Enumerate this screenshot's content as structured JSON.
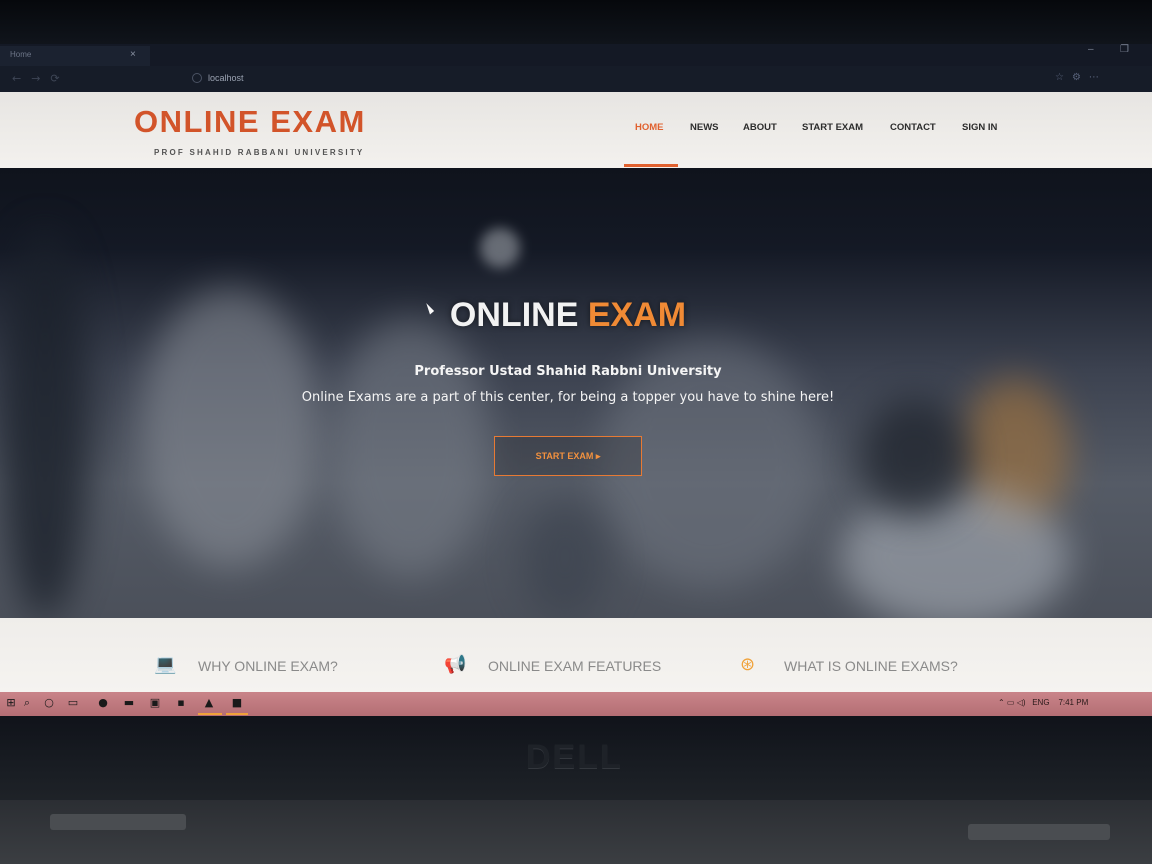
{
  "browser": {
    "tab_title": "Home",
    "tab_close": "×",
    "address": "localhost",
    "window_min": "–",
    "window_max": "❐"
  },
  "site": {
    "logo_title": "ONLINE EXAM",
    "logo_subtitle": "PROF SHAHID RABBANI UNIVERSITY",
    "nav": {
      "home": "HOME",
      "news": "NEWS",
      "about": "ABOUT",
      "start_exam": "START EXAM",
      "contact": "CONTACT",
      "sign_in": "SIGN IN"
    },
    "hero": {
      "title_part1": "ONLINE",
      "title_part2": "EXAM",
      "line1": "Professor Ustad Shahid Rabbni University",
      "line2": "Online Exams are a part of this center, for being a topper you have to shine here!",
      "button_label": "START EXAM ▸"
    },
    "features": {
      "f1": "WHY ONLINE EXAM?",
      "f2": "ONLINE EXAM FEATURES",
      "f3": "WHAT IS ONLINE EXAMS?"
    }
  },
  "taskbar": {
    "lang": "ENG",
    "time": "7:41 PM"
  },
  "device": {
    "brand": "DELL"
  },
  "colors": {
    "accent": "#e0612f",
    "logo": "#d2542a",
    "hero_accent": "#f08a35"
  }
}
